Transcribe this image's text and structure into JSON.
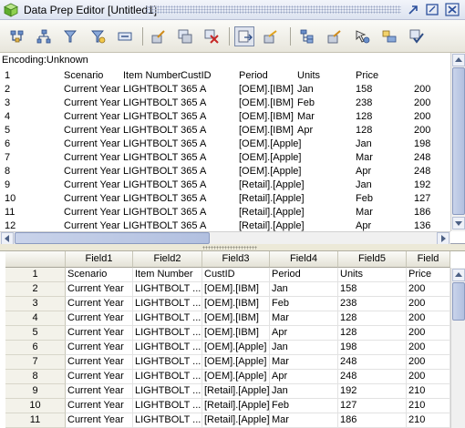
{
  "window": {
    "title": "Data Prep Editor [Untitled1]",
    "icons": [
      "cube-icon",
      "restore-icon",
      "maximize-icon",
      "close-icon"
    ]
  },
  "toolbar": {
    "icons": [
      "open-source-icon",
      "hierarchy-icon",
      "filter-icon",
      "sort-icon",
      "text-field-icon",
      "rule-icon",
      "data-grid-icon",
      "delete-rule-icon",
      "replace-icon",
      "field-edit-icon",
      "dimension-build-icon",
      "load-icon",
      "transform-icon",
      "join-icon",
      "validate-icon"
    ]
  },
  "preview": {
    "encoding": "Encoding:Unknown",
    "rows": [
      [
        "1",
        "Scenario",
        "Item Number",
        "CustID",
        "Period",
        "Units",
        "Price",
        ""
      ],
      [
        "2",
        "Current Year",
        "LIGHTBOLT 365 A",
        "",
        "[OEM].[IBM]",
        "Jan",
        "158",
        "200"
      ],
      [
        "3",
        "Current Year",
        "LIGHTBOLT 365 A",
        "",
        "[OEM].[IBM]",
        "Feb",
        "238",
        "200"
      ],
      [
        "4",
        "Current Year",
        "LIGHTBOLT 365 A",
        "",
        "[OEM].[IBM]",
        "Mar",
        "128",
        "200"
      ],
      [
        "5",
        "Current Year",
        "LIGHTBOLT 365 A",
        "",
        "[OEM].[IBM]",
        "Apr",
        "128",
        "200"
      ],
      [
        "6",
        "Current Year",
        "LIGHTBOLT 365 A",
        "",
        "[OEM].[Apple]",
        "",
        "Jan",
        "198"
      ],
      [
        "7",
        "Current Year",
        "LIGHTBOLT 365 A",
        "",
        "[OEM].[Apple]",
        "",
        "Mar",
        "248"
      ],
      [
        "8",
        "Current Year",
        "LIGHTBOLT 365 A",
        "",
        "[OEM].[Apple]",
        "",
        "Apr",
        "248"
      ],
      [
        "9",
        "Current Year",
        "LIGHTBOLT 365 A",
        "",
        "[Retail].[Apple]",
        "",
        "Jan",
        "192"
      ],
      [
        "10",
        "Current Year",
        "LIGHTBOLT 365 A",
        "",
        "[Retail].[Apple]",
        "",
        "Feb",
        "127"
      ],
      [
        "11",
        "Current Year",
        "LIGHTBOLT 365 A",
        "",
        "[Retail].[Apple]",
        "",
        "Mar",
        "186"
      ],
      [
        "12",
        "Current Year",
        "LIGHTBOLT 365 A",
        "",
        "[Retail].[Apple]",
        "",
        "Apr",
        "136"
      ]
    ]
  },
  "grid": {
    "columns": [
      "",
      "Field1",
      "Field2",
      "Field3",
      "Field4",
      "Field5",
      "Field"
    ],
    "rows": [
      [
        "1",
        "Scenario",
        "Item Number",
        "CustID",
        "Period",
        "Units",
        "Price"
      ],
      [
        "2",
        "Current Year",
        "LIGHTBOLT ...",
        "[OEM].[IBM]",
        "Jan",
        "158",
        "200"
      ],
      [
        "3",
        "Current Year",
        "LIGHTBOLT ...",
        "[OEM].[IBM]",
        "Feb",
        "238",
        "200"
      ],
      [
        "4",
        "Current Year",
        "LIGHTBOLT ...",
        "[OEM].[IBM]",
        "Mar",
        "128",
        "200"
      ],
      [
        "5",
        "Current Year",
        "LIGHTBOLT ...",
        "[OEM].[IBM]",
        "Apr",
        "128",
        "200"
      ],
      [
        "6",
        "Current Year",
        "LIGHTBOLT ...",
        "[OEM].[Apple]",
        "Jan",
        "198",
        "200"
      ],
      [
        "7",
        "Current Year",
        "LIGHTBOLT ...",
        "[OEM].[Apple]",
        "Mar",
        "248",
        "200"
      ],
      [
        "8",
        "Current Year",
        "LIGHTBOLT ...",
        "[OEM].[Apple]",
        "Apr",
        "248",
        "200"
      ],
      [
        "9",
        "Current Year",
        "LIGHTBOLT ...",
        "[Retail].[Apple]",
        "Jan",
        "192",
        "210"
      ],
      [
        "10",
        "Current Year",
        "LIGHTBOLT ...",
        "[Retail].[Apple]",
        "Feb",
        "127",
        "210"
      ],
      [
        "11",
        "Current Year",
        "LIGHTBOLT ...",
        "[Retail].[Apple]",
        "Mar",
        "186",
        "210"
      ]
    ]
  }
}
